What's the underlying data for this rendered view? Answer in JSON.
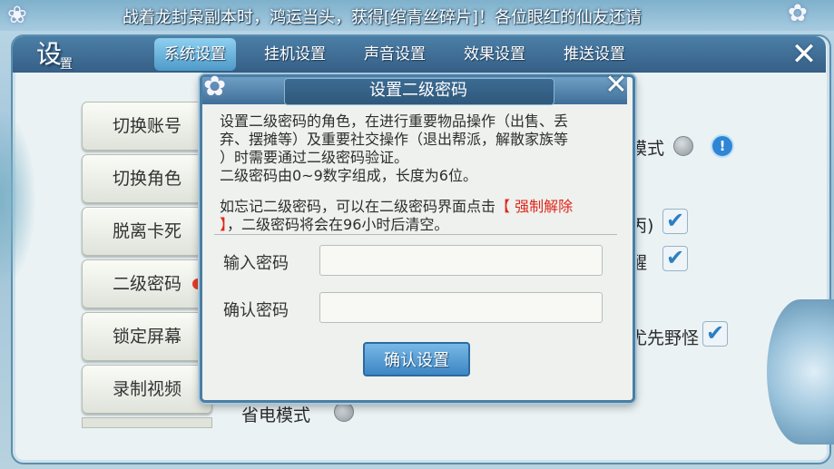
{
  "marquee": {
    "text": "战着龙封枭副本时，鸿运当头，获得[绾青丝碎片]！各位眼红的仙友还请"
  },
  "window": {
    "title_chars": [
      "设",
      "置"
    ],
    "tabs": [
      {
        "label": "系统设置",
        "active": true
      },
      {
        "label": "挂机设置",
        "active": false
      },
      {
        "label": "声音设置",
        "active": false
      },
      {
        "label": "效果设置",
        "active": false
      },
      {
        "label": "推送设置",
        "active": false
      }
    ],
    "close_icon": "close-icon"
  },
  "sidebar": {
    "items": [
      {
        "label": "切换账号"
      },
      {
        "label": "切换角色"
      },
      {
        "label": "脱离卡死"
      },
      {
        "label": "二级密码",
        "has_red_dot": true
      },
      {
        "label": "锁定屏幕"
      },
      {
        "label": "录制视频"
      }
    ]
  },
  "background_options": {
    "mode_fragment": "模式",
    "item2_fragment": "丙)",
    "item3_fragment": "醒",
    "item4_fragment": "尤先野怪",
    "power_save_label": "省电模式"
  },
  "modal": {
    "title": "设置二级密码",
    "desc_lines": [
      "设置二级密码的角色，在进行重要物品操作（出售、丢",
      "弃、摆摊等）及重要社交操作（退出帮派，解散家族等",
      "）时需要通过二级密码验证。",
      "二级密码由0~9数字组成，长度为6位。"
    ],
    "forgot_prefix": "如忘记二级密码，可以在二级密码界面点击",
    "forgot_link": "【 强制解除",
    "forgot_link_end": "】",
    "forgot_suffix": "，二级密码将会在96小时后清空。",
    "password_label": "输入密码",
    "password_value": "",
    "confirm_label": "确认密码",
    "confirm_value": "",
    "submit_label": "确认设置"
  },
  "colors": {
    "accent": "#3d86c4",
    "warning": "#e0261a",
    "header": "#365f86"
  }
}
